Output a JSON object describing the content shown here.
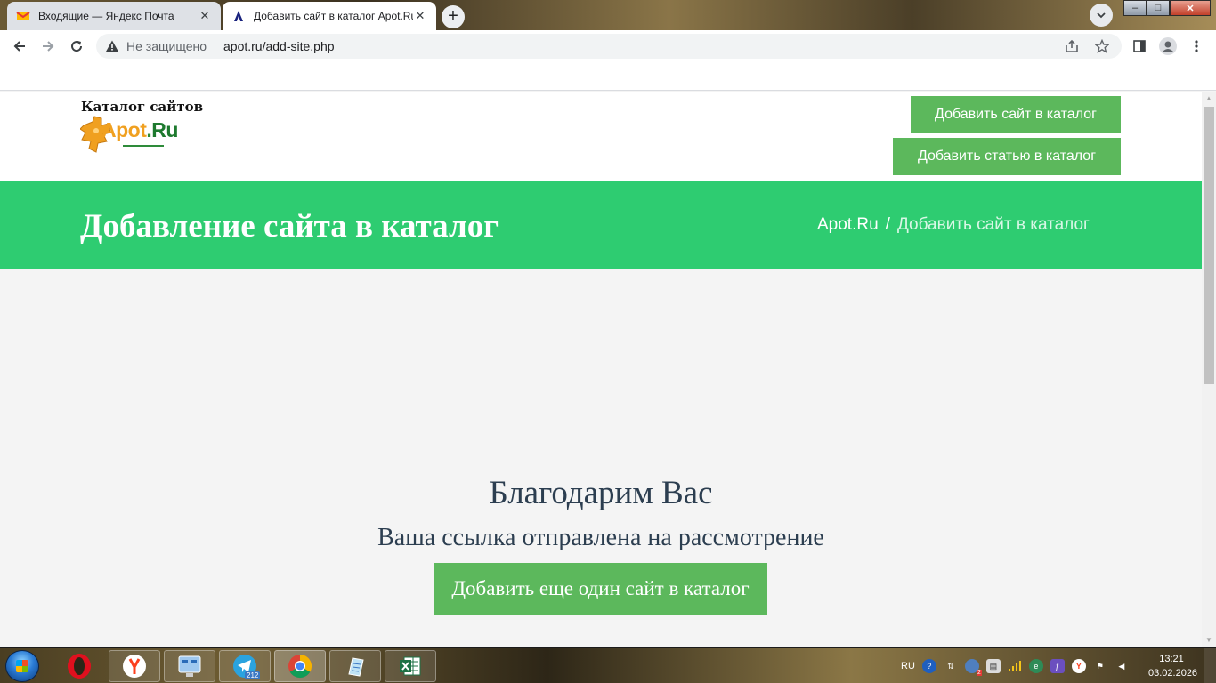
{
  "browser": {
    "tabs": [
      {
        "title": "Входящие — Яндекс Почта",
        "close": "✕"
      },
      {
        "title": "Добавить сайт в каталог Apot.Ru",
        "close": "✕"
      }
    ],
    "new_tab": "+",
    "window_controls": {
      "minimize": "–",
      "maximize": "□",
      "close": "✕"
    },
    "address_bar": {
      "security_label": "Не защищено",
      "url": "apot.ru/add-site.php"
    }
  },
  "site": {
    "logo_caption": "Каталог сайтов",
    "logo": {
      "part1": "Apot",
      "dot": ".",
      "part2": "Ru"
    },
    "header_buttons": {
      "add_site": "Добавить сайт в каталог",
      "add_article": "Добавить статью в каталог"
    },
    "banner": {
      "title": "Добавление сайта в каталог",
      "breadcrumb_home": "Apot.Ru",
      "breadcrumb_separator": "/",
      "breadcrumb_current": "Добавить сайт в каталог"
    },
    "content": {
      "thanks": "Благодарим Вас",
      "message": "Ваша ссылка отправлена на рассмотрение",
      "add_another_button": "Добавить еще один сайт в каталог"
    }
  },
  "taskbar": {
    "telegram_badge": "212",
    "tray": {
      "language": "RU",
      "mail_badge": "2"
    },
    "clock": {
      "time": "13:21",
      "date": "03.02.2026"
    }
  },
  "colors": {
    "banner_green": "#2ecc71",
    "button_green": "#5cb85c",
    "heading_text": "#2c3e50"
  }
}
